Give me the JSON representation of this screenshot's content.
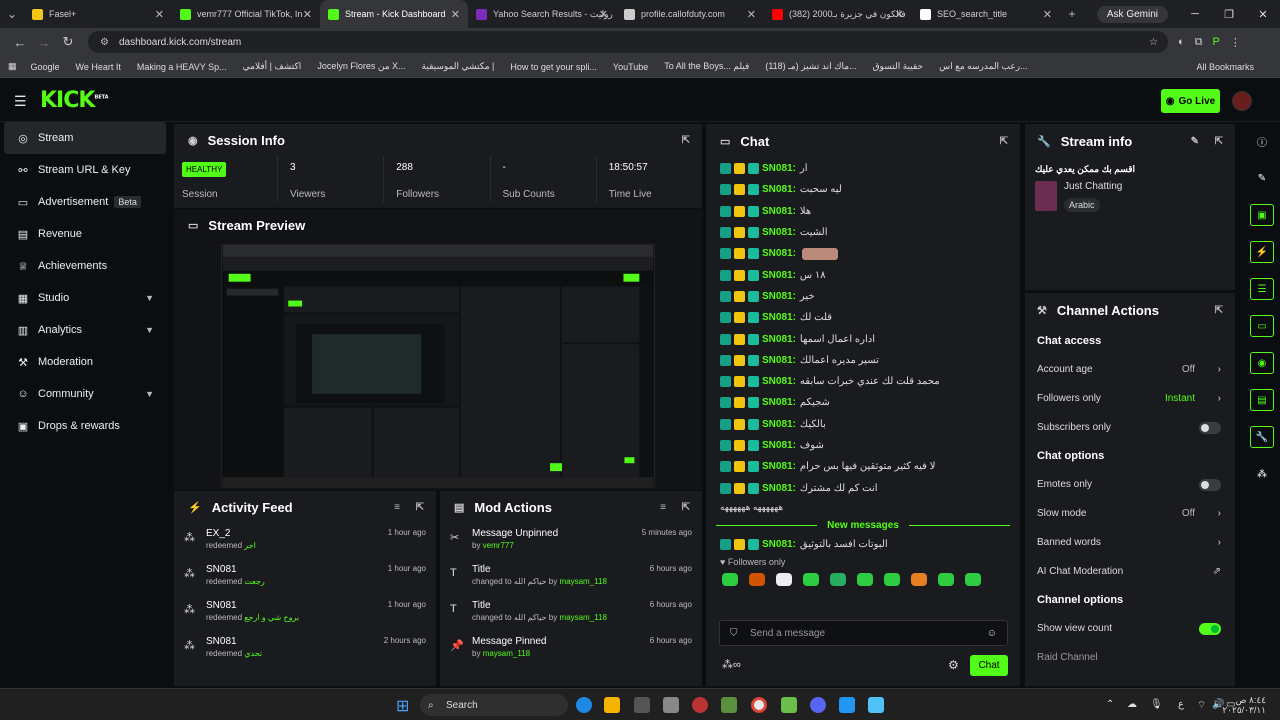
{
  "browser": {
    "tabs": [
      {
        "label": "Fasel+",
        "color": "#f5c518"
      },
      {
        "label": "vemr777 Official TikTok, In",
        "color": "#53fc18"
      },
      {
        "label": "Stream - Kick Dashboard",
        "color": "#53fc18"
      },
      {
        "label": "Yahoo Search Results - روليت",
        "color": "#7b2cbf"
      },
      {
        "label": "profile.callofduty.com",
        "color": "#cccccc"
      },
      {
        "label": "(382) فالكون في جزيرة بـ2000",
        "color": "#ff0000"
      },
      {
        "label": "SEO_search_title",
        "color": "#ffffff"
      }
    ],
    "ask_gemini": "Ask Gemini",
    "url": "dashboard.kick.com/stream",
    "bookmarks": [
      "Google",
      "We Heart It",
      "Making a HEAVY Sp...",
      "اكتشف | أفلامي",
      "Jocelyn Flores من X...",
      "مكتشي الموسيقية |",
      "How to get your spli...",
      "YouTube",
      "To All the Boys... فيلم",
      "(118) ماك اند تشيز (مـ...",
      "حقيبة التسوق",
      "رعب المدرسه مع اس..."
    ],
    "all_bookmarks": "All Bookmarks"
  },
  "header": {
    "logo": "KICK",
    "logo_sup": "BETA",
    "go_live": "Go Live"
  },
  "sidebar": {
    "items": [
      {
        "label": "Stream",
        "icon": "broadcast-icon"
      },
      {
        "label": "Stream URL & Key",
        "icon": "link-icon"
      },
      {
        "label": "Advertisement",
        "icon": "ad-icon",
        "badge": "Beta"
      },
      {
        "label": "Revenue",
        "icon": "revenue-icon"
      },
      {
        "label": "Achievements",
        "icon": "trophy-icon"
      },
      {
        "label": "Studio",
        "icon": "studio-icon"
      },
      {
        "label": "Analytics",
        "icon": "chart-icon"
      },
      {
        "label": "Moderation",
        "icon": "hammer-icon"
      },
      {
        "label": "Community",
        "icon": "community-icon"
      },
      {
        "label": "Drops & rewards",
        "icon": "gift-icon"
      }
    ]
  },
  "session": {
    "title": "Session Info",
    "status": "HEALTHY",
    "status_label": "Session",
    "viewers": "3",
    "viewers_label": "Viewers",
    "followers": "288",
    "followers_label": "Followers",
    "subs": "-",
    "subs_label": "Sub Counts",
    "time": "18:50:57",
    "time_label": "Time Live"
  },
  "preview": {
    "title": "Stream Preview"
  },
  "activity": {
    "title": "Activity Feed",
    "items": [
      {
        "name": "EX_2",
        "action": "redeemed",
        "reward": "اجر",
        "time": "1 hour ago"
      },
      {
        "name": "SN081",
        "action": "redeemed",
        "reward": "رجعت",
        "time": "1 hour ago"
      },
      {
        "name": "SN081",
        "action": "redeemed",
        "reward": "بروح شي و ارجع",
        "time": "1 hour ago"
      },
      {
        "name": "SN081",
        "action": "redeemed",
        "reward": "تحدي",
        "time": "2 hours ago"
      }
    ]
  },
  "mod": {
    "title": "Mod Actions",
    "items": [
      {
        "name": "Message Unpinned",
        "pre": "by",
        "user": "vemr777",
        "mid": "",
        "val": "",
        "time": "5 minutes ago"
      },
      {
        "name": "Title",
        "pre": "changed to",
        "user": "maysam_118",
        "mid": "حياكم الله by",
        "val": "",
        "time": "6 hours ago"
      },
      {
        "name": "Title",
        "pre": "changed to",
        "user": "maysam_118",
        "mid": "حياكم الله by",
        "val": "",
        "time": "6 hours ago"
      },
      {
        "name": "Message Pinned",
        "pre": "by",
        "user": "maysam_118",
        "mid": "",
        "val": "",
        "time": "6 hours ago"
      }
    ]
  },
  "chat": {
    "title": "Chat",
    "messages": [
      {
        "user": "SN081:",
        "text": "ار"
      },
      {
        "user": "SN081:",
        "text": "ليه سحبت"
      },
      {
        "user": "SN081:",
        "text": "هلا"
      },
      {
        "user": "SN081:",
        "text": "الشيت"
      },
      {
        "user": "SN081:",
        "text": ""
      },
      {
        "user": "SN081:",
        "text": "١٨ س"
      },
      {
        "user": "SN081:",
        "text": "خير"
      },
      {
        "user": "SN081:",
        "text": "قلت لك"
      },
      {
        "user": "SN081:",
        "text": "اداره اعمال اسمها"
      },
      {
        "user": "SN081:",
        "text": "تسير مديره اعمالك"
      },
      {
        "user": "SN081:",
        "text": "محمد قلت لك عندي خبرات سابقه"
      },
      {
        "user": "SN081:",
        "text": "شجيكم"
      },
      {
        "user": "SN081:",
        "text": "بالكيك"
      },
      {
        "user": "SN081:",
        "text": "شوف"
      },
      {
        "user": "SN081:",
        "text": "لا فيه كثير متوثقين فيها بس حرام"
      },
      {
        "user": "SN081:",
        "text": "انت كم لك مشترك"
      },
      {
        "user": "SN081:",
        "text": "ههههههه ههههههه ههههههه ههههههه"
      }
    ],
    "last_line": "ههههههه ههههههه",
    "new_messages": "New messages",
    "new_msg": {
      "user": "SN081:",
      "text": "البوتات افسد بالتوثيق"
    },
    "followers_only": "Followers only",
    "placeholder": "Send a message",
    "send": "Chat"
  },
  "stream_info": {
    "title": "Stream info",
    "stream_title": "اقسم بك ممكن يعدي عليك",
    "category": "Just Chatting",
    "language": "Arabic"
  },
  "channel_actions": {
    "title": "Channel Actions",
    "chat_access": "Chat access",
    "account_age": "Account age",
    "account_age_val": "Off",
    "followers_only": "Followers only",
    "followers_only_val": "Instant",
    "subscribers_only": "Subscribers only",
    "chat_options": "Chat options",
    "emotes_only": "Emotes only",
    "slow_mode": "Slow mode",
    "slow_mode_val": "Off",
    "banned_words": "Banned words",
    "ai_mod": "AI Chat Moderation",
    "channel_options": "Channel options",
    "show_view_count": "Show view count",
    "raid_channel": "Raid Channel"
  },
  "taskbar": {
    "search": "Search",
    "time": "٨:٤٤ ص",
    "date": "٢٠٢٥/٠٣/١١",
    "lang": "ع"
  }
}
